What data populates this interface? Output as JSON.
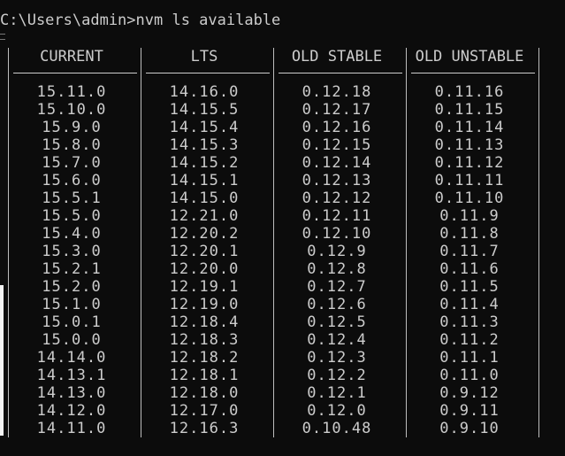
{
  "terminal": {
    "prompt": "C:\\Users\\admin>nvm ls available"
  },
  "table": {
    "headers": [
      "CURRENT",
      "LTS",
      "OLD STABLE",
      "OLD UNSTABLE"
    ],
    "columns": {
      "current": [
        "15.11.0",
        "15.10.0",
        "15.9.0",
        "15.8.0",
        "15.7.0",
        "15.6.0",
        "15.5.1",
        "15.5.0",
        "15.4.0",
        "15.3.0",
        "15.2.1",
        "15.2.0",
        "15.1.0",
        "15.0.1",
        "15.0.0",
        "14.14.0",
        "14.13.1",
        "14.13.0",
        "14.12.0",
        "14.11.0"
      ],
      "lts": [
        "14.16.0",
        "14.15.5",
        "14.15.4",
        "14.15.3",
        "14.15.2",
        "14.15.1",
        "14.15.0",
        "12.21.0",
        "12.20.2",
        "12.20.1",
        "12.20.0",
        "12.19.1",
        "12.19.0",
        "12.18.4",
        "12.18.3",
        "12.18.2",
        "12.18.1",
        "12.18.0",
        "12.17.0",
        "12.16.3"
      ],
      "old_stable": [
        "0.12.18",
        "0.12.17",
        "0.12.16",
        "0.12.15",
        "0.12.14",
        "0.12.13",
        "0.12.12",
        "0.12.11",
        "0.12.10",
        "0.12.9",
        "0.12.8",
        "0.12.7",
        "0.12.6",
        "0.12.5",
        "0.12.4",
        "0.12.3",
        "0.12.2",
        "0.12.1",
        "0.12.0",
        "0.10.48"
      ],
      "old_unstable": [
        "0.11.16",
        "0.11.15",
        "0.11.14",
        "0.11.13",
        "0.11.12",
        "0.11.11",
        "0.11.10",
        "0.11.9",
        "0.11.8",
        "0.11.7",
        "0.11.6",
        "0.11.5",
        "0.11.4",
        "0.11.3",
        "0.11.2",
        "0.11.1",
        "0.11.0",
        "0.9.12",
        "0.9.11",
        "0.9.10"
      ]
    }
  }
}
